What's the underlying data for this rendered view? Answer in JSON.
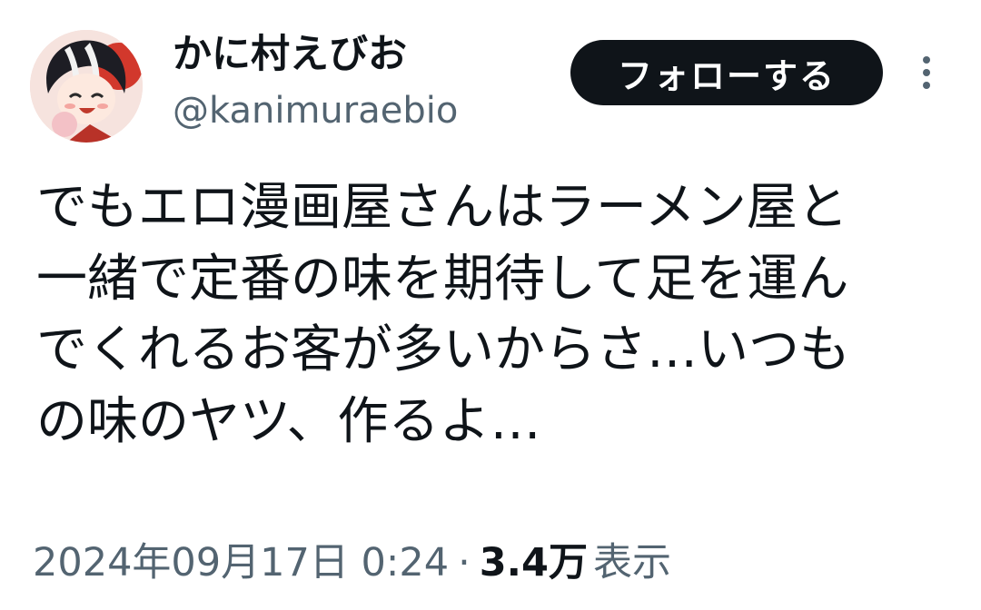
{
  "author": {
    "display_name": "かに村えびお",
    "handle": "@kanimuraebio",
    "avatar_icon": "user-avatar-icon"
  },
  "actions": {
    "follow_label": "フォローする",
    "more_icon": "more-vertical-icon"
  },
  "tweet": {
    "lines": [
      "でもエロ漫画屋さんはラーメン屋と",
      "一緒で定番の味を期待して足を運ん",
      "でくれるお客が多いからさ…いつも",
      "の味のヤツ、作るよ…"
    ]
  },
  "meta": {
    "timestamp": "2024年09月17日 0:24",
    "separator": "·",
    "views_count": "3.4万",
    "views_label": "表示"
  },
  "colors": {
    "text_primary": "#0f1419",
    "text_secondary": "#536471",
    "button_bg": "#0f1419",
    "button_text": "#ffffff",
    "background": "#ffffff"
  }
}
